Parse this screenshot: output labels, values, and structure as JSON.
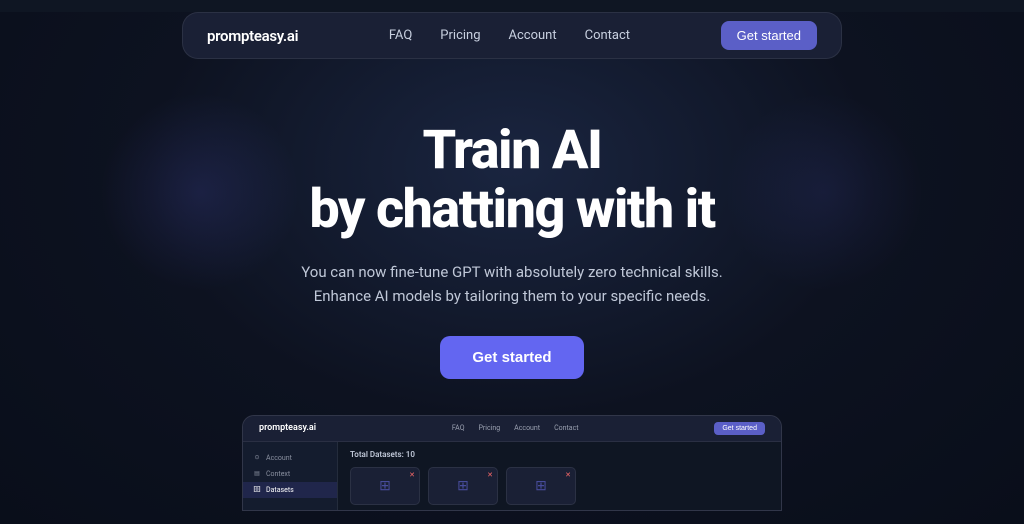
{
  "navbar": {
    "logo": "prompteasy.ai",
    "links": [
      {
        "label": "FAQ",
        "id": "faq"
      },
      {
        "label": "Pricing",
        "id": "pricing"
      },
      {
        "label": "Account",
        "id": "account"
      },
      {
        "label": "Contact",
        "id": "contact"
      }
    ],
    "cta_label": "Get started"
  },
  "hero": {
    "title_line1": "Train AI",
    "title_line2": "by chatting with it",
    "subtitle_line1": "You can now fine-tune GPT with absolutely zero technical skills.",
    "subtitle_line2": "Enhance AI models by tailoring them to your specific needs.",
    "cta_label": "Get started"
  },
  "preview": {
    "logo": "prompteasy.ai",
    "nav_links": [
      "FAQ",
      "Pricing",
      "Account",
      "Contact"
    ],
    "cta": "Get started",
    "sidebar_items": [
      {
        "label": "Account",
        "icon": "⊙",
        "active": false
      },
      {
        "label": "Context",
        "icon": "📄",
        "active": false
      },
      {
        "label": "Datasets",
        "icon": "🗄",
        "active": true
      }
    ],
    "main_title": "Total Datasets: 10",
    "cards": [
      {
        "has_close": true
      },
      {
        "has_close": true
      },
      {
        "has_close": true
      }
    ]
  },
  "colors": {
    "accent": "#6366f1",
    "bg_dark": "#0f1623",
    "bg_card": "#1a2035",
    "text_light": "#ffffff",
    "text_muted": "#c0c8d8"
  }
}
